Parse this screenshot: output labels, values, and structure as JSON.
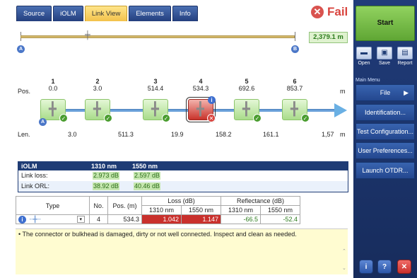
{
  "tabs": [
    "Source",
    "iOLM",
    "Link View",
    "Elements",
    "Info"
  ],
  "status": {
    "icon": "fail-icon",
    "text": "Fail"
  },
  "overview": {
    "start": "A",
    "end": "B",
    "distance": "2,379.1 m"
  },
  "link": {
    "pos_label": "Pos.",
    "len_label": "Len.",
    "unit": "m",
    "columns": [
      {
        "n": "1",
        "pos": "0.0"
      },
      {
        "n": "2",
        "pos": "3.0"
      },
      {
        "n": "3",
        "pos": "514.4"
      },
      {
        "n": "4",
        "pos": "534.3"
      },
      {
        "n": "5",
        "pos": "692.6"
      },
      {
        "n": "6",
        "pos": "853.7"
      }
    ],
    "lengths": [
      "3.0",
      "511.3",
      "19.9",
      "158.2",
      "161.1",
      "1,57"
    ]
  },
  "summary": {
    "title": "iOLM",
    "wl1": "1310 nm",
    "wl2": "1550 nm",
    "rows": [
      {
        "label": "Link loss:",
        "v1": "2.973 dB",
        "v2": "2.597 dB"
      },
      {
        "label": "Link ORL:",
        "v1": "38.92 dB",
        "v2": "40.46 dB"
      }
    ]
  },
  "table": {
    "headers": {
      "type": "Type",
      "no": "No.",
      "pos": "Pos. (m)",
      "loss": "Loss (dB)",
      "refl": "Reflectance (dB)",
      "wl1": "1310 nm",
      "wl2": "1550 nm"
    },
    "row": {
      "no": "4",
      "pos": "534.3",
      "loss1": "1.042",
      "loss2": "1.147",
      "refl1": "-66.5",
      "refl2": "-52.4"
    }
  },
  "diagnostic": "• The connector or bulkhead is damaged, dirty or not well connected. Inspect and clean as needed.",
  "panel": {
    "start": "Start",
    "file_buttons": [
      "Open",
      "Save",
      "Report"
    ],
    "main_menu_label": "Main Menu",
    "menu": [
      "File",
      "Identification...",
      "Test Configuration...",
      "User Preferences...",
      "Launch OTDR..."
    ]
  },
  "colors": {
    "accent": "#1f3c75",
    "pass": "#4a9d2f",
    "fail": "#d9453f",
    "active_tab": "#f3c24b"
  }
}
